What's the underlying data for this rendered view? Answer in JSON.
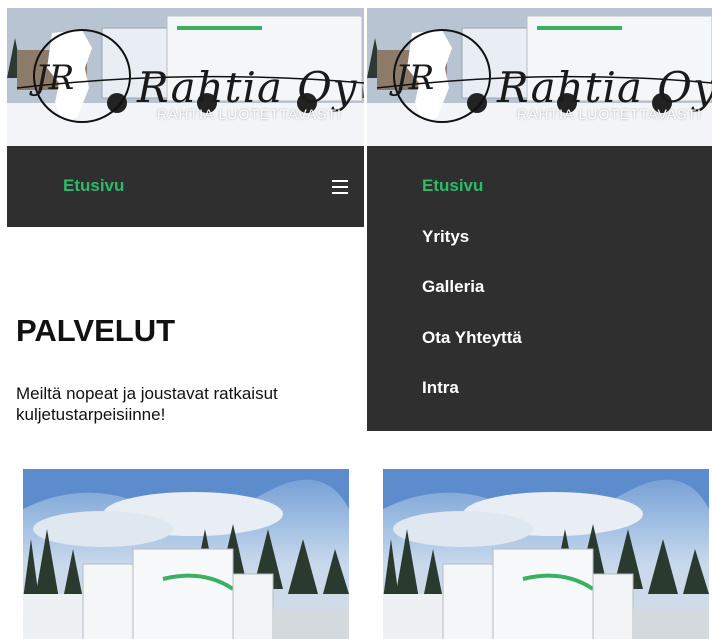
{
  "header": {
    "logo_monogram": "JR",
    "logo_wordmark": "Rahtia Oy",
    "tagline": "RAHTIA LUOTETTAVASTI"
  },
  "nav": {
    "active_label": "Etusivu",
    "menu_items": [
      {
        "label": "Etusivu",
        "active": true
      },
      {
        "label": "Yritys",
        "active": false
      },
      {
        "label": "Galleria",
        "active": false
      },
      {
        "label": "Ota Yhteyttä",
        "active": false
      },
      {
        "label": "Intra",
        "active": false
      }
    ],
    "menu_icon": "hamburger-menu-icon"
  },
  "content": {
    "title": "PALVELUT",
    "text": "Meiltä nopeat ja joustavat ratkaisut kuljetustarpeisiinne!"
  },
  "colors": {
    "nav_bg": "#2f2f2f",
    "accent_green": "#2dbb67",
    "text": "#111111"
  }
}
